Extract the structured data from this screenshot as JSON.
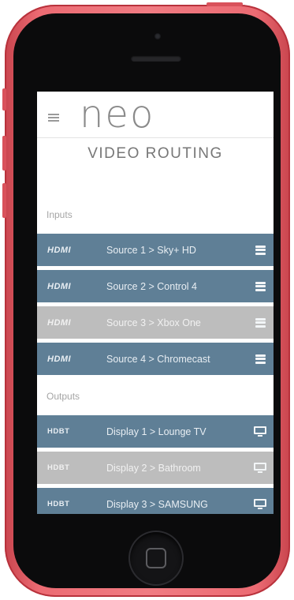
{
  "app": {
    "logo_text": "neo",
    "page_title": "VIDEO ROUTING"
  },
  "colors": {
    "active_row": "#5f7f96",
    "inactive_row": "#bdbdbd",
    "phone_body": "#ec6b73"
  },
  "inputs": {
    "section_label": "Inputs",
    "items": [
      {
        "brand": "HDMI",
        "label": "Source 1 > Sky+ HD",
        "icon": "list-icon",
        "state": "active"
      },
      {
        "brand": "HDMI",
        "label": "Source 2 > Control 4",
        "icon": "list-icon",
        "state": "active"
      },
      {
        "brand": "HDMI",
        "label": "Source 3 > Xbox One",
        "icon": "list-icon",
        "state": "inactive"
      },
      {
        "brand": "HDMI",
        "label": "Source 4 > Chromecast",
        "icon": "list-icon",
        "state": "active"
      }
    ]
  },
  "outputs": {
    "section_label": "Outputs",
    "items": [
      {
        "brand": "HDBT",
        "label": "Display 1 > Lounge TV",
        "icon": "display-icon",
        "state": "active"
      },
      {
        "brand": "HDBT",
        "label": "Display 2 > Bathroom",
        "icon": "display-icon",
        "state": "inactive"
      },
      {
        "brand": "HDBT",
        "label": "Display 3 > SAMSUNG",
        "icon": "display-icon",
        "state": "active"
      }
    ]
  }
}
